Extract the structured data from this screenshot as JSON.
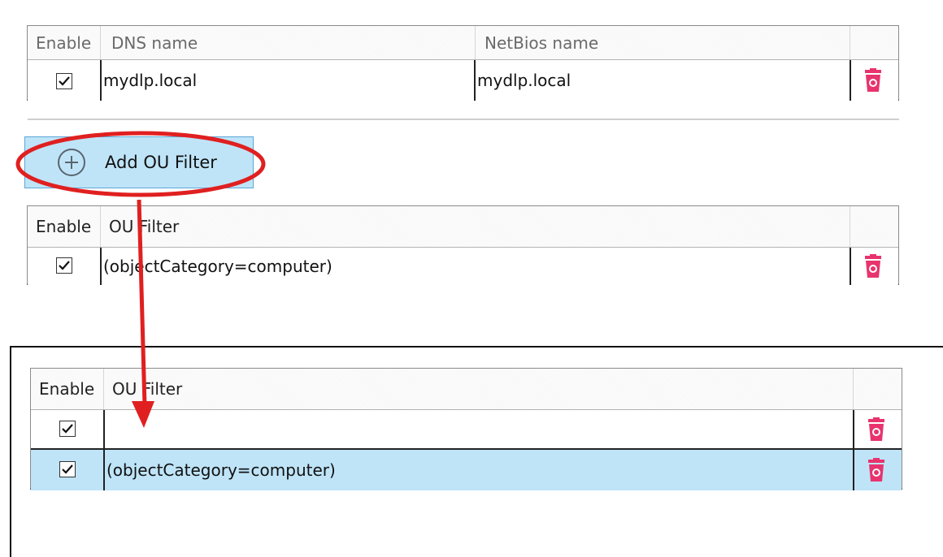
{
  "domain_grid": {
    "headers": {
      "enable": "Enable",
      "dns": "DNS name",
      "netbios": "NetBios name"
    },
    "rows": [
      {
        "enabled": true,
        "dns": "mydlp.local",
        "netbios": "mydlp.local"
      }
    ]
  },
  "add_ou_button": {
    "label": "Add OU Filter",
    "icon": "plus-circle-icon"
  },
  "ou_grid_before": {
    "headers": {
      "enable": "Enable",
      "filter": "OU Filter"
    },
    "rows": [
      {
        "enabled": true,
        "filter": "(objectCategory=computer)"
      }
    ]
  },
  "ou_grid_after": {
    "headers": {
      "enable": "Enable",
      "filter": "OU Filter"
    },
    "rows": [
      {
        "enabled": true,
        "filter": ""
      },
      {
        "enabled": true,
        "filter": "(objectCategory=computer)",
        "selected": true
      }
    ]
  },
  "colors": {
    "highlight": "#e02020",
    "selection": "#bfe4f8",
    "trash": "#e8336e"
  },
  "icons": {
    "checkbox": "checkmark-icon",
    "delete": "trash-icon"
  }
}
